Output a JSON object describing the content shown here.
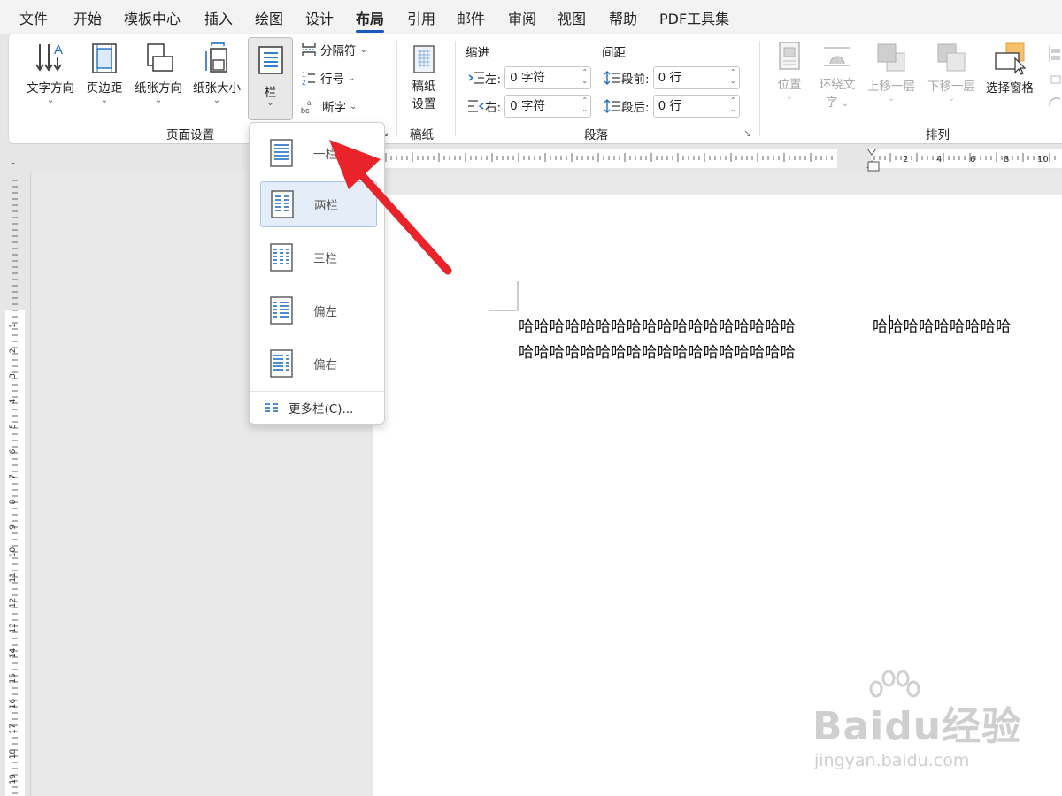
{
  "menu": {
    "tabs": [
      "文件",
      "开始",
      "模板中心",
      "插入",
      "绘图",
      "设计",
      "布局",
      "引用",
      "邮件",
      "审阅",
      "视图",
      "帮助",
      "PDF工具集"
    ],
    "active": "布局"
  },
  "ribbon": {
    "page_setup": {
      "text_direction": "文字方向",
      "margins": "页边距",
      "orientation": "纸张方向",
      "size": "纸张大小",
      "columns": "栏",
      "breaks": "分隔符",
      "line_numbers": "行号",
      "hyphenation": "断字",
      "group_label": "页面设置"
    },
    "manuscript": {
      "setup_line1": "稿纸",
      "setup_line2": "设置",
      "group_label": "稿纸"
    },
    "paragraph": {
      "indent_title": "缩进",
      "spacing_title": "间距",
      "left_label": "左:",
      "left_value": "0 字符",
      "right_label": "右:",
      "right_value": "0 字符",
      "before_label": "段前:",
      "before_value": "0 行",
      "after_label": "段后:",
      "after_value": "0 行",
      "group_label": "段落"
    },
    "arrange": {
      "position": "位置",
      "wrap_line1": "环绕文",
      "wrap_line2": "字",
      "bring_forward": "上移一层",
      "send_backward": "下移一层",
      "selection_pane": "选择窗格",
      "group_label": "排列"
    }
  },
  "columns_menu": {
    "one": "一栏",
    "two": "两栏",
    "three": "三栏",
    "left": "偏左",
    "right": "偏右",
    "more": "更多栏(C)..."
  },
  "ruler": {
    "labels": [
      "2",
      "4",
      "6",
      "8",
      "10"
    ],
    "vlabels": [
      "1",
      "2",
      "3",
      "4",
      "5",
      "6",
      "7",
      "8",
      "9",
      "10",
      "11",
      "12",
      "13",
      "14",
      "15",
      "16",
      "17",
      "18",
      "19"
    ]
  },
  "document": {
    "col1_line1": "哈哈哈哈哈哈哈哈哈哈哈哈哈哈哈哈哈哈",
    "col1_line2": "哈哈哈哈哈哈哈哈哈哈哈哈哈哈哈哈哈哈",
    "col2_line1": "哈哈哈哈哈哈哈哈哈"
  },
  "watermark": {
    "brand": "Baidu经验",
    "url": "jingyan.baidu.com"
  }
}
